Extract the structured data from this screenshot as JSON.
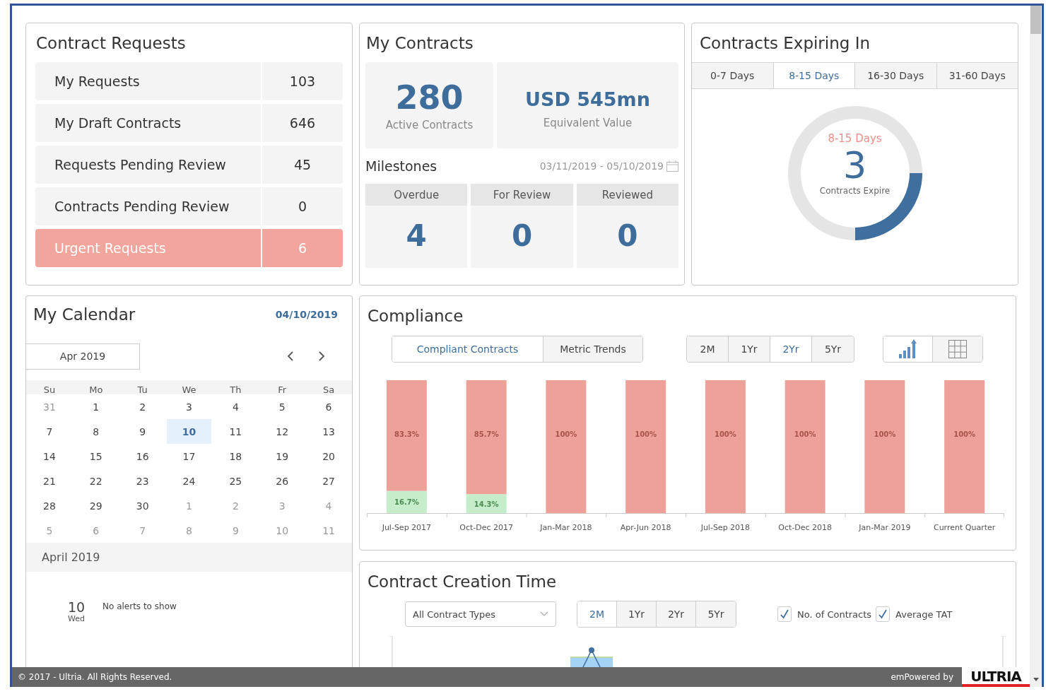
{
  "requests": {
    "title": "Contract Requests",
    "items": [
      {
        "label": "My Requests",
        "count": "103",
        "urgent": false
      },
      {
        "label": "My Draft Contracts",
        "count": "646",
        "urgent": false
      },
      {
        "label": "Requests Pending Review",
        "count": "45",
        "urgent": false
      },
      {
        "label": "Contracts Pending Review",
        "count": "0",
        "urgent": false
      },
      {
        "label": "Urgent Requests",
        "count": "6",
        "urgent": true
      }
    ]
  },
  "my_contracts": {
    "title": "My Contracts",
    "stats": [
      {
        "value": "280",
        "label": "Active Contracts",
        "kind": "count"
      },
      {
        "value": "USD 545mn",
        "label": "Equivalent Value",
        "kind": "money"
      }
    ],
    "milestones": {
      "title": "Milestones",
      "date_range": "03/11/2019 - 05/10/2019",
      "items": [
        {
          "label": "Overdue",
          "value": "4"
        },
        {
          "label": "For Review",
          "value": "0"
        },
        {
          "label": "Reviewed",
          "value": "0"
        }
      ]
    }
  },
  "expiring": {
    "title": "Contracts Expiring In",
    "tabs": [
      {
        "label": "0-7 Days",
        "selected": false
      },
      {
        "label": "8-15 Days",
        "selected": true
      },
      {
        "label": "16-30 Days",
        "selected": false
      },
      {
        "label": "31-60 Days",
        "selected": false
      }
    ],
    "donut": {
      "label": "8-15 Days",
      "value": "3",
      "caption": "Contracts Expire"
    }
  },
  "calendar": {
    "title": "My Calendar",
    "date": "04/10/2019",
    "month": "Apr 2019",
    "weekdays": [
      "Su",
      "Mo",
      "Tu",
      "We",
      "Th",
      "Fr",
      "Sa"
    ],
    "weeks": [
      [
        {
          "day": "31",
          "muted": true,
          "selected": false
        },
        {
          "day": "1",
          "muted": false,
          "selected": false
        },
        {
          "day": "2",
          "muted": false,
          "selected": false
        },
        {
          "day": "3",
          "muted": false,
          "selected": false
        },
        {
          "day": "4",
          "muted": false,
          "selected": false
        },
        {
          "day": "5",
          "muted": false,
          "selected": false
        },
        {
          "day": "6",
          "muted": false,
          "selected": false
        }
      ],
      [
        {
          "day": "7",
          "muted": false,
          "selected": false
        },
        {
          "day": "8",
          "muted": false,
          "selected": false
        },
        {
          "day": "9",
          "muted": false,
          "selected": false
        },
        {
          "day": "10",
          "muted": false,
          "selected": true
        },
        {
          "day": "11",
          "muted": false,
          "selected": false
        },
        {
          "day": "12",
          "muted": false,
          "selected": false
        },
        {
          "day": "13",
          "muted": false,
          "selected": false
        }
      ],
      [
        {
          "day": "14",
          "muted": false,
          "selected": false
        },
        {
          "day": "15",
          "muted": false,
          "selected": false
        },
        {
          "day": "16",
          "muted": false,
          "selected": false
        },
        {
          "day": "17",
          "muted": false,
          "selected": false
        },
        {
          "day": "18",
          "muted": false,
          "selected": false
        },
        {
          "day": "19",
          "muted": false,
          "selected": false
        },
        {
          "day": "20",
          "muted": false,
          "selected": false
        }
      ],
      [
        {
          "day": "21",
          "muted": false,
          "selected": false
        },
        {
          "day": "22",
          "muted": false,
          "selected": false
        },
        {
          "day": "23",
          "muted": false,
          "selected": false
        },
        {
          "day": "24",
          "muted": false,
          "selected": false
        },
        {
          "day": "25",
          "muted": false,
          "selected": false
        },
        {
          "day": "26",
          "muted": false,
          "selected": false
        },
        {
          "day": "27",
          "muted": false,
          "selected": false
        }
      ],
      [
        {
          "day": "28",
          "muted": false,
          "selected": false
        },
        {
          "day": "29",
          "muted": false,
          "selected": false
        },
        {
          "day": "30",
          "muted": false,
          "selected": false
        },
        {
          "day": "1",
          "muted": true,
          "selected": false
        },
        {
          "day": "2",
          "muted": true,
          "selected": false
        },
        {
          "day": "3",
          "muted": true,
          "selected": false
        },
        {
          "day": "4",
          "muted": true,
          "selected": false
        }
      ],
      [
        {
          "day": "5",
          "muted": true,
          "selected": false
        },
        {
          "day": "6",
          "muted": true,
          "selected": false
        },
        {
          "day": "7",
          "muted": true,
          "selected": false
        },
        {
          "day": "8",
          "muted": true,
          "selected": false
        },
        {
          "day": "9",
          "muted": true,
          "selected": false
        },
        {
          "day": "10",
          "muted": true,
          "selected": false
        },
        {
          "day": "11",
          "muted": true,
          "selected": false
        }
      ]
    ],
    "agenda": {
      "heading": "April 2019",
      "day": "10",
      "weekday": "Wed",
      "message": "No alerts to show"
    }
  },
  "compliance": {
    "title": "Compliance",
    "views": [
      {
        "label": "Compliant Contracts",
        "selected": true
      },
      {
        "label": "Metric Trends",
        "selected": false
      }
    ],
    "periods": [
      {
        "label": "2M",
        "selected": false
      },
      {
        "label": "1Yr",
        "selected": false
      },
      {
        "label": "2Yr",
        "selected": true
      },
      {
        "label": "5Yr",
        "selected": false
      }
    ],
    "display": [
      {
        "kind": "chart",
        "selected": true
      },
      {
        "kind": "table",
        "selected": false
      }
    ],
    "chart_data": {
      "type": "bar",
      "stacked": true,
      "categories": [
        "Jul-Sep 2017",
        "Oct-Dec 2017",
        "Jan-Mar 2018",
        "Apr-Jun 2018",
        "Jul-Sep 2018",
        "Oct-Dec 2018",
        "Jan-Mar 2019",
        "Current Quarter"
      ],
      "series": [
        {
          "color": "#c6edca",
          "values": [
            16.7,
            14.3,
            0,
            0,
            0,
            0,
            0,
            0
          ],
          "value_labels": [
            "16.7%",
            "14.3%",
            null,
            null,
            null,
            null,
            null,
            null
          ]
        },
        {
          "color": "#eda198",
          "values": [
            83.3,
            85.7,
            100,
            100,
            100,
            100,
            100,
            100
          ],
          "value_labels": [
            "83.3%",
            "85.7%",
            "100%",
            "100%",
            "100%",
            "100%",
            "100%",
            "100%"
          ]
        }
      ]
    }
  },
  "creation_time": {
    "title": "Contract Creation Time",
    "filter": {
      "value": "All Contract Types"
    },
    "periods": [
      {
        "label": "2M",
        "selected": true
      },
      {
        "label": "1Yr",
        "selected": false
      },
      {
        "label": "2Yr",
        "selected": false
      },
      {
        "label": "5Yr",
        "selected": false
      }
    ],
    "toggles": [
      {
        "label": "No. of Contracts",
        "checked": true
      },
      {
        "label": "Average TAT",
        "checked": true
      }
    ]
  },
  "footer": {
    "copyright": "© 2017 - Ultria. All Rights Reserved.",
    "powered_by": "emPowered by",
    "logo": "ULTRIA"
  }
}
